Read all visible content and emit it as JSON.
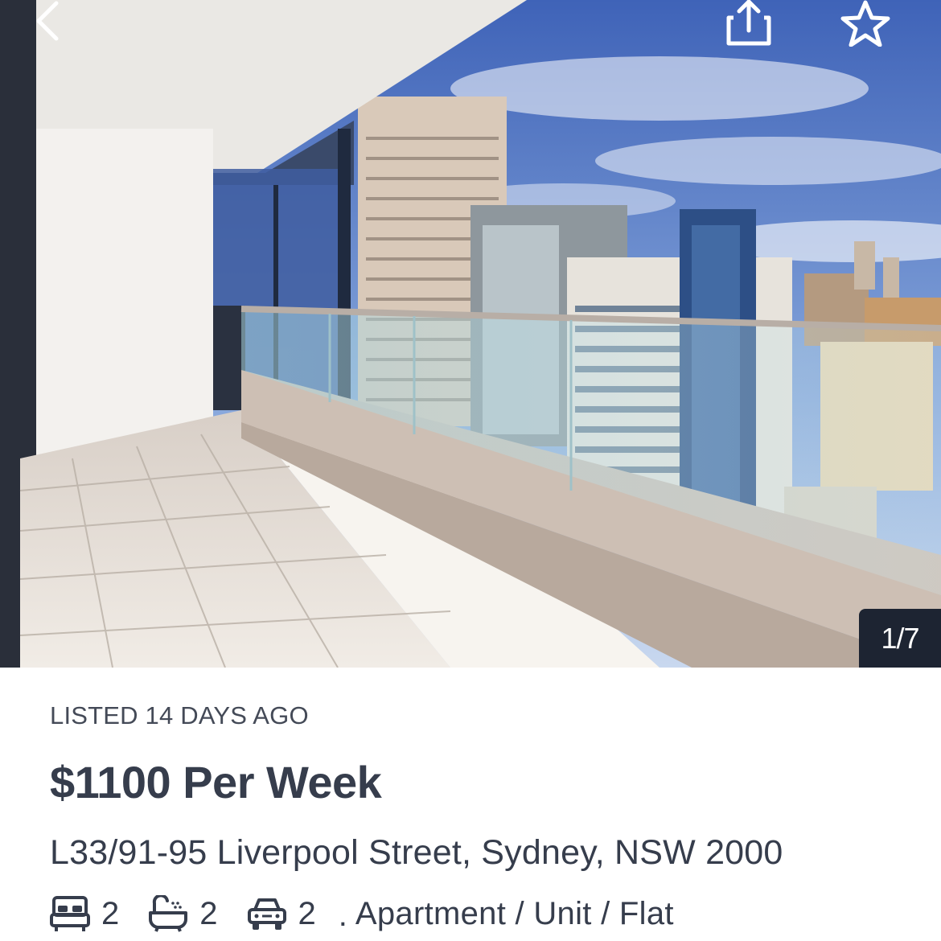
{
  "photo": {
    "description_icon": "balcony-city-view-photo",
    "counter": "1/7"
  },
  "toolbar": {
    "back_icon": "chevron-left-icon",
    "share_icon": "share-icon",
    "favourite_icon": "star-icon"
  },
  "listing": {
    "listed": "LISTED 14 DAYS AGO",
    "price": "$1100 Per Week",
    "address": "L33/91-95 Liverpool Street, Sydney, NSW 2000",
    "bedrooms": "2",
    "bathrooms": "2",
    "parking": "2",
    "separator": ".",
    "property_type": "Apartment / Unit / Flat"
  },
  "colors": {
    "text": "#363d4c",
    "counter_bg": "#1d2432"
  }
}
